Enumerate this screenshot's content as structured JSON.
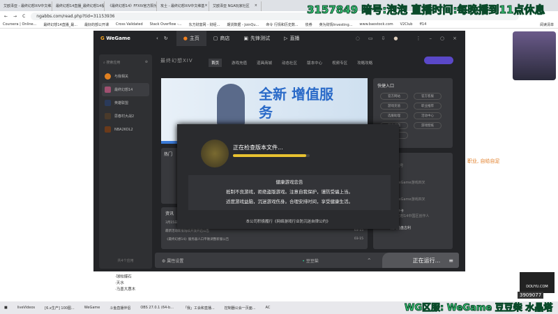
{
  "browser": {
    "tabs": [
      "艾欧泽亚 - 最终幻想XIV中文维基",
      "最终幻想14直播_最终幻想14视",
      "《最终幻想14》FFXIV官方阳光",
      "攻士 - 最终幻想XIV中文维基",
      "艾欧泽亚 NGA玩家社区"
    ],
    "url": "ngabbs.com/read.php?tid=31153936",
    "bookmarks": [
      "Coursera | Online...",
      "最终幻想14直播_最...",
      "最好的部公开课",
      "Cross Validated",
      "Stack Overflow -...",
      "东方财富网 - 财经...",
      "期货数据 - JoinQu...",
      "命令 行情和历史数...",
      "债券",
      "英为财情Investing...",
      "www.baostock.com",
      "V2Club",
      "ff14",
      "阅读清单"
    ]
  },
  "stream_overlay": {
    "top": "3157849 暗号:泡泡  直播时间:每晚播到11点休息",
    "bottom": "WG区服: WeGame 豆豆柴 水晶塔",
    "viewer_count": "3909077",
    "side_text": "职业, 自给自足",
    "douyu": "DOUYU.COM"
  },
  "page_left_list": [
    "·球帖爆石",
    "·天水",
    "·马墨大惠木"
  ],
  "wegame": {
    "logo": "WeGame",
    "nav": [
      "主页",
      "商店",
      "先锋测试",
      "直播"
    ],
    "search_placeholder": "搜索应用",
    "sidebar": [
      "与我相关",
      "最终幻想14",
      "英雄联盟",
      "思春村大战2",
      "NBA2KOL2"
    ],
    "sidebar_footer": "共4个应用",
    "game_logo": "最终幻想XIV",
    "subnav": [
      "首页",
      "游戏充值",
      "道具商城",
      "动态社区",
      "版本中心",
      "视频专区",
      "攻略攻略"
    ],
    "banner_text": "全新 增值服务",
    "quick": {
      "title": "快捷入口",
      "items": [
        "官方网站",
        "官方客服",
        "游戏充值",
        "职业推荐",
        "选服助理",
        "活动中心",
        "新手指南",
        "游戏壁纸",
        "更多"
      ]
    },
    "hot_title": "热门",
    "news": {
      "title": "资讯",
      "items": [
        {
          "t": "3月15日最新维护说明(公告)5.5版本《晓月之终途》开启",
          "d": "03-16"
        },
        {
          "t": "最新活动新服陆续开放开启公告",
          "d": "03-15"
        },
        {
          "t": "《最终幻想14》服务器人口平衡调整新服公告",
          "d": "03-15"
        }
      ]
    },
    "feed": [
      {
        "n": "最终幻想XIV",
        "s": "WeGame 游戏号"
      },
      {
        "n": "云阁",
        "s": "最终幻想14 WeGame游戏四叉"
      },
      {
        "n": "偶大猫千里里",
        "s": "最终幻想14 WeGame游戏四叉"
      },
      {
        "n": "卡卡卡卡",
        "s": "最终幻想14中国区创作人"
      },
      {
        "n": "发疯的盘古利",
        "s": ""
      }
    ],
    "bottom": {
      "settings": "属性设置",
      "server": "豆豆柴",
      "running": "正在运行..."
    },
    "modal": {
      "status": "正在检查版本文件...",
      "progress": 0.95,
      "notice_title": "健康游戏忠告",
      "notice_1": "抵制不良游戏，拒绝盗版游戏。注意自我保护，谨防受骗上当。",
      "notice_2": "适度游戏益脑，沉迷游戏伤身。合理安排时间，享受健康生活。",
      "footer": "本公司积极履行《网络游戏行业防沉迷自律公约》"
    }
  },
  "taskbar": [
    "liveVideos",
    "[6.x生产] 100图...",
    "WeGame",
    "斗鱼直播伴侣",
    "OBS 27.0.1 (64-b...",
    "「我」工会和直播...",
    "控制器公会一页面...",
    "AC"
  ]
}
